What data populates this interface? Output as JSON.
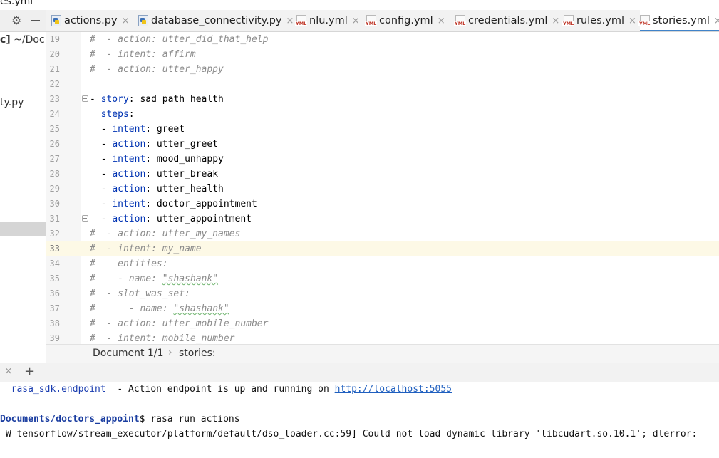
{
  "window": {
    "title_fragment": "es.yml"
  },
  "project_panel": {
    "root_label_bold": "c]",
    "root_path": " ~/Doc",
    "file_fragment": "ty.py"
  },
  "tabs": [
    {
      "label": "actions.py",
      "icon": "python-file-icon",
      "active": false
    },
    {
      "label": "database_connectivity.py",
      "icon": "python-file-icon",
      "active": false
    },
    {
      "label": "nlu.yml",
      "icon": "yaml-file-icon",
      "active": false
    },
    {
      "label": "config.yml",
      "icon": "yaml-file-icon",
      "active": false
    },
    {
      "label": "credentials.yml",
      "icon": "yaml-file-icon",
      "active": false
    },
    {
      "label": "rules.yml",
      "icon": "yaml-file-icon",
      "active": false
    },
    {
      "label": "stories.yml",
      "icon": "yaml-file-icon",
      "active": true
    }
  ],
  "yml_badge": "YML",
  "close_glyph": "×",
  "editor": {
    "current_line": 33,
    "lines": [
      {
        "n": "19",
        "text": "#  - action: utter_did_that_help"
      },
      {
        "n": "20",
        "text": "#  - intent: affirm"
      },
      {
        "n": "21",
        "text": "#  - action: utter_happy"
      },
      {
        "n": "22",
        "text": ""
      },
      {
        "n": "23",
        "dash": "- ",
        "key": "story",
        "rest": ": sad path health"
      },
      {
        "n": "24",
        "indent": "  ",
        "key": "steps",
        "rest": ":"
      },
      {
        "n": "25",
        "indent": "  ",
        "dash": "- ",
        "key": "intent",
        "rest": ": greet"
      },
      {
        "n": "26",
        "indent": "  ",
        "dash": "- ",
        "key": "action",
        "rest": ": utter_greet"
      },
      {
        "n": "27",
        "indent": "  ",
        "dash": "- ",
        "key": "intent",
        "rest": ": mood_unhappy"
      },
      {
        "n": "28",
        "indent": "  ",
        "dash": "- ",
        "key": "action",
        "rest": ": utter_break"
      },
      {
        "n": "29",
        "indent": "  ",
        "dash": "- ",
        "key": "action",
        "rest": ": utter_health"
      },
      {
        "n": "30",
        "indent": "  ",
        "dash": "- ",
        "key": "intent",
        "rest": ": doctor_appointment"
      },
      {
        "n": "31",
        "indent": "  ",
        "dash": "- ",
        "key": "action",
        "rest": ": utter_appointment"
      },
      {
        "n": "32",
        "text": "#  - action: utter_my_names"
      },
      {
        "n": "33",
        "text": "#  - intent: my_name"
      },
      {
        "n": "34",
        "text": "#    entities:"
      },
      {
        "n": "35",
        "text": "#    - name: ",
        "squiggle": "\"shashank\""
      },
      {
        "n": "36",
        "text": "#  - slot_was_set:"
      },
      {
        "n": "37",
        "text": "#      - name: ",
        "squiggle": "\"shashank\""
      },
      {
        "n": "38",
        "text": "#  - action: utter_mobile_number"
      },
      {
        "n": "39",
        "text": "#  - intent: mobile_number"
      }
    ]
  },
  "breadcrumb": {
    "document": "Document 1/1",
    "separator": "›",
    "path": "stories:"
  },
  "terminal_tabs": {
    "close": "×",
    "add": "+"
  },
  "terminal": {
    "line1_module": "  rasa_sdk.endpoint",
    "line1_message": "  - Action endpoint is up and running on ",
    "line1_link": "http://localhost:5055",
    "prompt_path": "Documents/doctors_appoint",
    "prompt_cmd": "$ rasa run actions",
    "warning": " W tensorflow/stream_executor/platform/default/dso_loader.cc:59] Could not load dynamic library 'libcudart.so.10.1'; dlerror: "
  }
}
